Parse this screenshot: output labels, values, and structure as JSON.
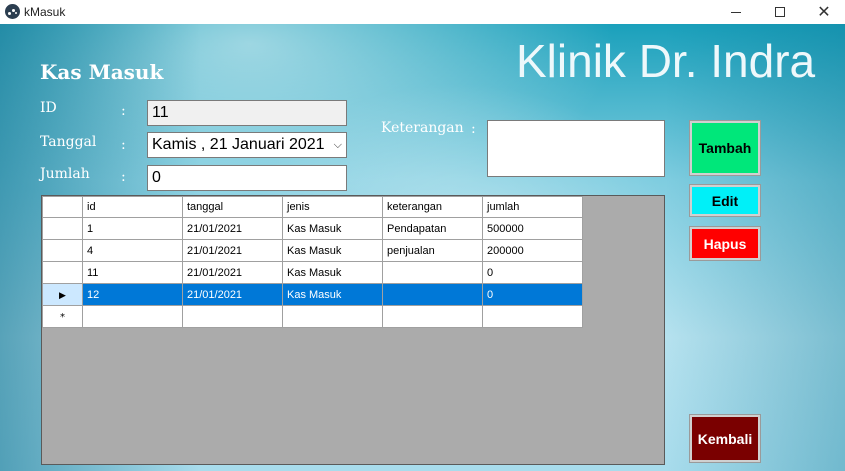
{
  "window": {
    "title": "kMasuk",
    "icon": "app-logo-icon",
    "controls": {
      "minimize": "minimize-icon",
      "maximize": "maximize-icon",
      "close": "close-icon"
    }
  },
  "header": {
    "form_title": "Kas Masuk",
    "brand": "Klinik Dr. Indra"
  },
  "form": {
    "id_label": "ID",
    "id_value": "11",
    "tanggal_label": "Tanggal",
    "tanggal_value": "Kamis , 21    Januari    2021",
    "jumlah_label": "Jumlah",
    "jumlah_value": "0",
    "keterangan_label": "Keterangan",
    "keterangan_value": "",
    "colon": ":"
  },
  "buttons": {
    "tambah": "Tambah",
    "edit": "Edit",
    "hapus": "Hapus",
    "kembali": "Kembali"
  },
  "colors": {
    "tambah": "#00e77a",
    "edit": "#00f0f8",
    "hapus": "#ff0000",
    "kembali": "#7a0000",
    "selection": "#0078d7"
  },
  "table": {
    "columns": [
      "id",
      "tanggal",
      "jenis",
      "keterangan",
      "jumlah"
    ],
    "rows": [
      [
        "1",
        "21/01/2021",
        "Kas Masuk",
        "Pendapatan",
        "500000"
      ],
      [
        "4",
        "21/01/2021",
        "Kas Masuk",
        "penjualan",
        "200000"
      ],
      [
        "11",
        "21/01/2021",
        "Kas Masuk",
        "",
        "0"
      ],
      [
        "12",
        "21/01/2021",
        "Kas Masuk",
        "",
        "0"
      ]
    ],
    "selected_row": 3,
    "row_marker": "▶",
    "new_row_marker": "*"
  }
}
